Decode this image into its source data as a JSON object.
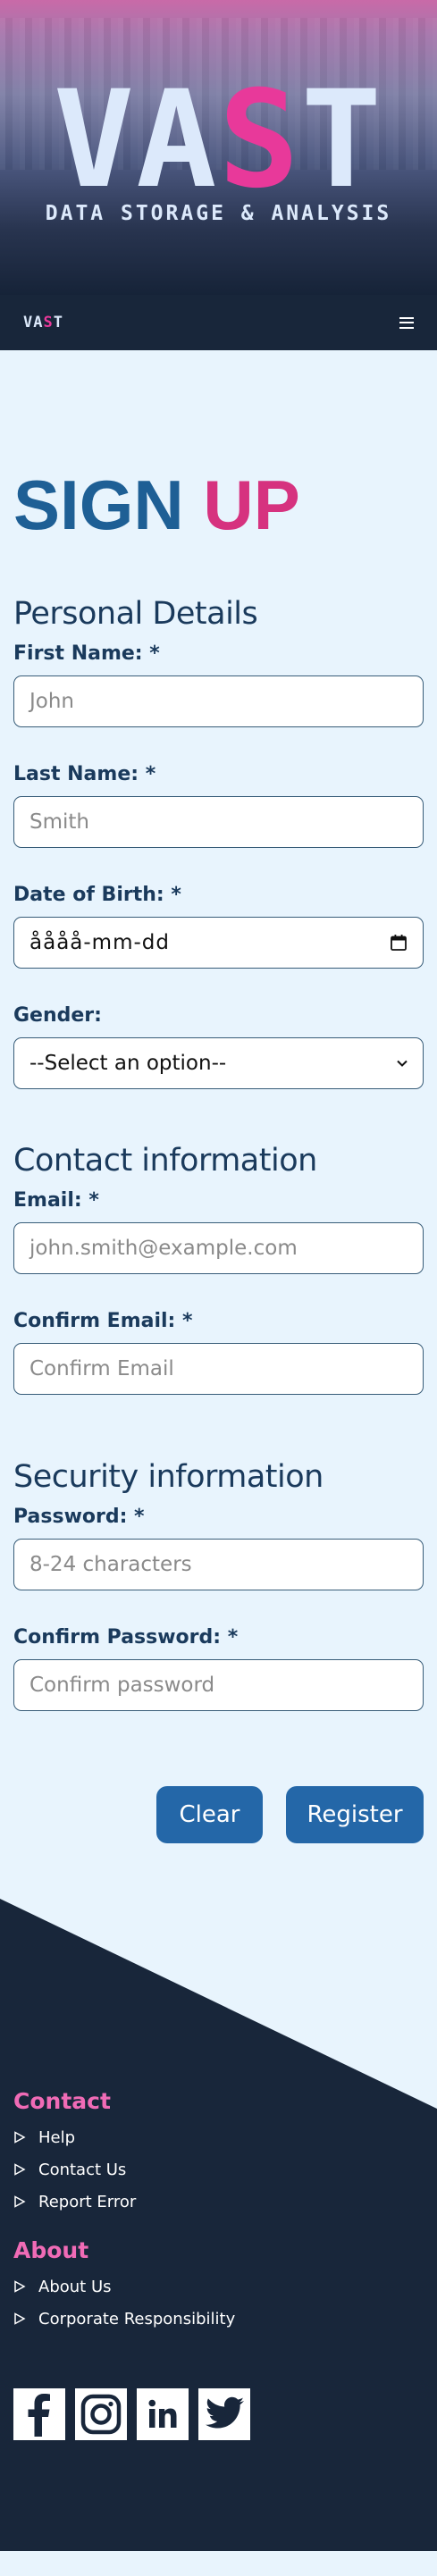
{
  "hero": {
    "logo_prefix": "VA",
    "logo_accent": "S",
    "logo_suffix": "T",
    "tagline": "DATA STORAGE & ANALYSIS"
  },
  "nav": {
    "logo_prefix": "VA",
    "logo_accent": "S",
    "logo_suffix": "T",
    "menu_icon": "hamburger-menu-icon"
  },
  "form": {
    "title_main": "SIGN",
    "title_accent": "UP",
    "personal": {
      "heading": "Personal Details",
      "first_name": {
        "label": "First Name: *",
        "placeholder": "John"
      },
      "last_name": {
        "label": "Last Name: *",
        "placeholder": "Smith"
      },
      "dob": {
        "label": "Date of Birth: *",
        "value": "åååå-mm-dd",
        "icon": "calendar-icon"
      },
      "gender": {
        "label": "Gender:",
        "selected": "--Select an option--"
      }
    },
    "contact": {
      "heading": "Contact information",
      "email": {
        "label": "Email: *",
        "placeholder": "john.smith@example.com"
      },
      "confirm_email": {
        "label": "Confirm Email: *",
        "placeholder": "Confirm Email"
      }
    },
    "security": {
      "heading": "Security information",
      "password": {
        "label": "Password: *",
        "placeholder": "8-24 characters"
      },
      "confirm_password": {
        "label": "Confirm Password: *",
        "placeholder": "Confirm password"
      }
    },
    "buttons": {
      "clear": "Clear",
      "register": "Register"
    }
  },
  "footer": {
    "contact_heading": "Contact",
    "contact_links": [
      "Help",
      "Contact Us",
      "Report Error"
    ],
    "about_heading": "About",
    "about_links": [
      "About Us",
      "Corporate Responsibility"
    ],
    "social_icons": [
      "facebook-icon",
      "instagram-icon",
      "linkedin-icon",
      "twitter-icon"
    ]
  },
  "colors": {
    "accent_pink": "#e8399a",
    "primary_blue": "#2467a8",
    "dark_navy": "#18263a",
    "page_bg": "#e8f4fd"
  }
}
